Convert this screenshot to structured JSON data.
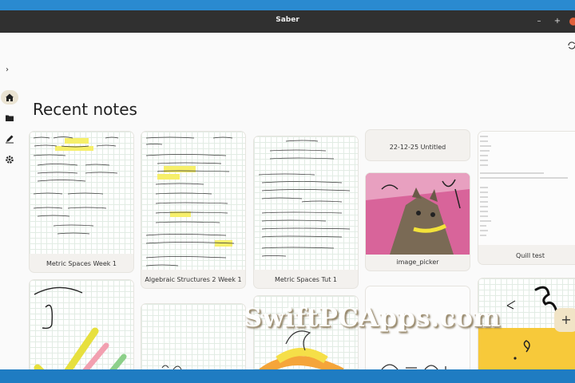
{
  "window": {
    "title": "Saber",
    "min": "–",
    "max": "+"
  },
  "page": {
    "heading": "Recent notes"
  },
  "sidebar": {
    "expand": "›",
    "items": [
      "home-icon",
      "folder-icon",
      "whiteboard-icon",
      "settings-icon"
    ]
  },
  "notes": [
    {
      "label": "Metric Spaces Week 1"
    },
    {
      "label": "Algebraic Structures 2 Week 1"
    },
    {
      "label": "Metric Spaces Tut 1"
    },
    {
      "label": "22-12-25 Untitled"
    },
    {
      "label": "image_picker"
    },
    {
      "label": "Quill test"
    }
  ],
  "fab": {
    "label": "+"
  },
  "watermark": "SwiftPCApps.com",
  "colors": {
    "accent": "#eae3d2",
    "titlebar": "#303030",
    "frame": "#1e7fc4"
  }
}
